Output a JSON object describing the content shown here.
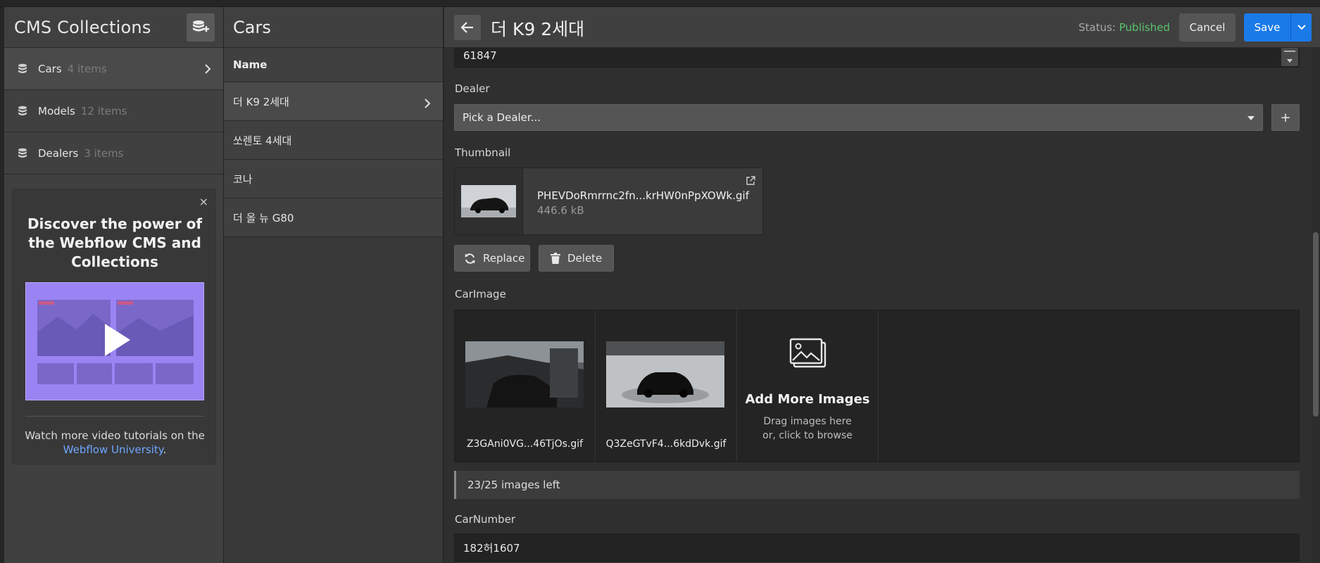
{
  "collections_panel": {
    "title": "CMS Collections",
    "add_icon": "add-collection-icon",
    "items": [
      {
        "name": "Cars",
        "count": "4 items"
      },
      {
        "name": "Models",
        "count": "12 items"
      },
      {
        "name": "Dealers",
        "count": "3 items"
      }
    ],
    "promo": {
      "close": "×",
      "heading": "Discover the power of the Webflow CMS and Collections",
      "text_before_link": "Watch more video tutorials on the",
      "link_text": "Webflow University",
      "text_after_link": "."
    }
  },
  "items_panel": {
    "title": "Cars",
    "column_header": "Name",
    "rows": [
      "더 K9 2세대",
      "쏘렌토 4세대",
      "코나",
      "더 올 뉴 G80"
    ]
  },
  "editor": {
    "title": "더 K9 2세대",
    "status_label": "Status:",
    "status_value": "Published",
    "cancel_label": "Cancel",
    "save_label": "Save",
    "number_field_value": "61847",
    "dealer": {
      "label": "Dealer",
      "placeholder": "Pick a Dealer...",
      "add": "+"
    },
    "thumbnail": {
      "label": "Thumbnail",
      "filename": "PHEVDoRmrrnc2fn...krHW0nPpXOWk.gif",
      "size": "446.6 kB",
      "replace_label": "Replace",
      "delete_label": "Delete"
    },
    "car_image": {
      "label": "CarImage",
      "images": [
        "Z3GAni0VG...46TjOs.gif",
        "Q3ZeGTvF4...6kdDvk.gif"
      ],
      "add_title": "Add More Images",
      "add_line1": "Drag images here",
      "add_line2": "or, click to browse",
      "remaining": "23/25 images left"
    },
    "car_number": {
      "label": "CarNumber",
      "value": "182허1607"
    }
  },
  "colors": {
    "accent": "#1a7ae8",
    "published": "#59c46c",
    "link": "#6fa7ff",
    "promo_video": "#9a84f3"
  }
}
